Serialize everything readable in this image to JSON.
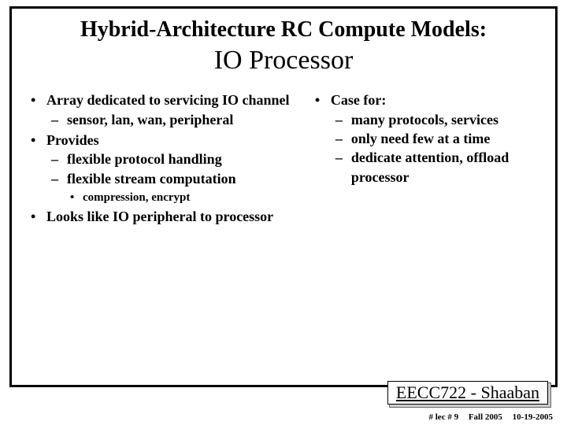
{
  "title": {
    "line1": "Hybrid-Architecture RC Compute Models:",
    "line2": "IO Processor"
  },
  "left": {
    "b0": "Array dedicated to servicing IO channel",
    "b0_d0": "sensor, lan, wan, peripheral",
    "b1": "Provides",
    "b1_d0": "flexible protocol handling",
    "b1_d1": "flexible stream computation",
    "b1_d1_s0": "compression, encrypt",
    "b2": "Looks like IO peripheral to processor"
  },
  "right": {
    "b0": "Case for:",
    "b0_d0": "many protocols, services",
    "b0_d1": "only need few at a time",
    "b0_d2": "dedicate attention, offload processor"
  },
  "footer": {
    "course": "EECC722 - Shaaban",
    "lec": "#  lec # 9",
    "term": "Fall 2005",
    "date": "10-19-2005"
  }
}
